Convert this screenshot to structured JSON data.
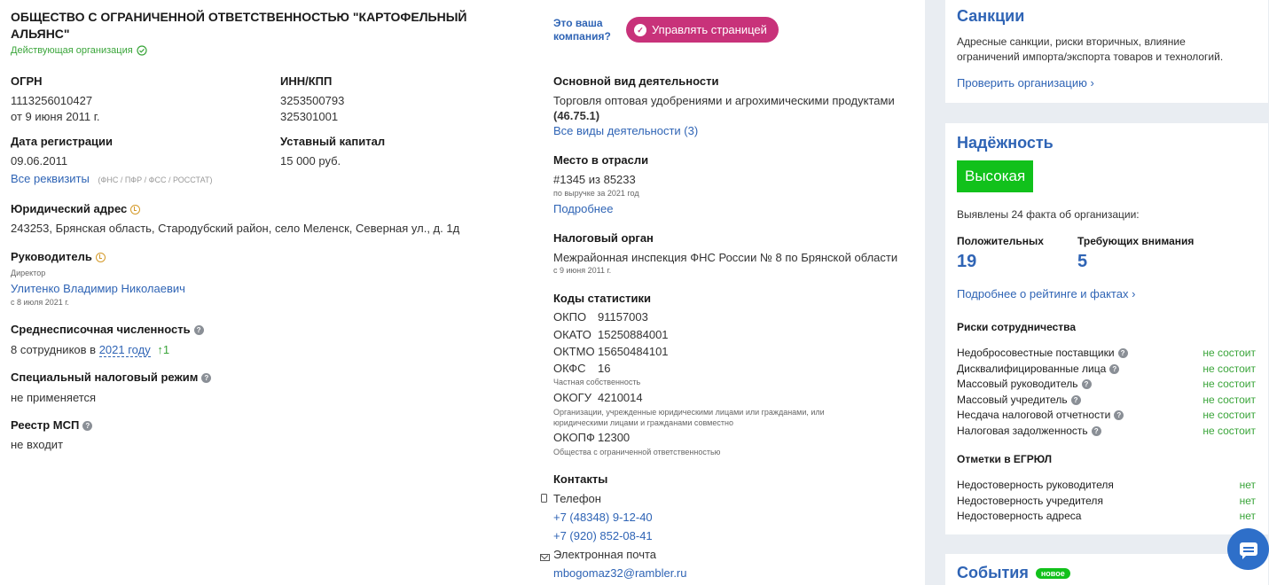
{
  "company": {
    "title": "ОБЩЕСТВО С ОГРАНИЧЕННОЙ ОТВЕТСТВЕННОСТЬЮ \"КАРТОФЕЛЬНЫЙ АЛЬЯНС\"",
    "status": "Действующая организация"
  },
  "ogrn": {
    "label": "ОГРН",
    "value": "1113256010427",
    "date": "от 9 июня 2011 г."
  },
  "inn": {
    "label": "ИНН/КПП",
    "inn": "3253500793",
    "kpp": "325301001"
  },
  "registration": {
    "label": "Дата регистрации",
    "value": "09.06.2011"
  },
  "capital": {
    "label": "Уставный капитал",
    "value": "15 000 руб."
  },
  "requisites": {
    "link": "Все реквизиты",
    "note": "(ФНС / ПФР / ФСС / РОССТАТ)"
  },
  "address": {
    "label": "Юридический адрес",
    "value": "243253, Брянская область, Стародубский район, село Меленск, Северная ул., д. 1д"
  },
  "head": {
    "label": "Руководитель",
    "role": "Директор",
    "name": "Улитенко Владимир Николаевич",
    "since": "с 8 июля 2021 г."
  },
  "employees": {
    "label": "Среднесписочная численность",
    "prefix": "8 сотрудников в",
    "year_link": "2021 году",
    "delta": "↑1"
  },
  "tax_regime": {
    "label": "Специальный налоговый режим",
    "value": "не применяется"
  },
  "msp": {
    "label": "Реестр МСП",
    "value": "не входит"
  },
  "claim": {
    "question_line1": "Это ваша",
    "question_line2": "компания?",
    "button": "Управлять страницей"
  },
  "activity": {
    "label": "Основной вид деятельности",
    "value": "Торговля оптовая удобрениями и агрохимическими продуктами",
    "code": "(46.75.1)",
    "link": "Все виды деятельности (3)"
  },
  "rank": {
    "label": "Место в отрасли",
    "value": "#1345 из 85233",
    "note": "по выручке за 2021 год",
    "link": "Подробнее"
  },
  "tax_authority": {
    "label": "Налоговый орган",
    "value": "Межрайонная инспекция ФНС России № 8 по Брянской области",
    "since": "с 9 июня 2011 г."
  },
  "stats": {
    "label": "Коды статистики",
    "okpo": {
      "k": "ОКПО",
      "v": "91157003"
    },
    "okato": {
      "k": "ОКАТО",
      "v": "15250884001"
    },
    "oktmo": {
      "k": "ОКТМО",
      "v": "15650484101"
    },
    "okfs": {
      "k": "ОКФС",
      "v": "16",
      "note": "Частная собственность"
    },
    "okogu": {
      "k": "ОКОГУ",
      "v": "4210014",
      "note1": "Организации, учрежденные юридическими лицами или гражданами, или",
      "note2": "юридическими лицами и гражданами совместно"
    },
    "okopf": {
      "k": "ОКОПФ",
      "v": "12300",
      "note": "Общества с ограниченной ответственностью"
    }
  },
  "contacts": {
    "label": "Контакты",
    "phone_label": "Телефон",
    "phone1": "+7 (48348) 9-12-40",
    "phone2": "+7 (920) 852-08-41",
    "email_label": "Электронная почта",
    "email": "mbogomaz32@rambler.ru"
  },
  "sanctions": {
    "title": "Санкции",
    "text1": "Адресные санкции, риски вторичных, влияние",
    "text2": "ограничений импорта/экспорта товаров и технологий.",
    "link": "Проверить организацию ›"
  },
  "reliability": {
    "title": "Надёжность",
    "badge": "Высокая",
    "facts": "Выявлены 24 факта об организации:",
    "positive_label": "Положительных",
    "positive_value": "19",
    "attention_label": "Требующих внимания",
    "attention_value": "5",
    "link": "Подробнее о рейтинге и фактах ›",
    "risks_title": "Риски сотрудничества",
    "risks": [
      {
        "label": "Недобросовестные поставщики",
        "value": "не состоит"
      },
      {
        "label": "Дисквалифицированные лица",
        "value": "не состоит"
      },
      {
        "label": "Массовый руководитель",
        "value": "не состоит"
      },
      {
        "label": "Массовый учредитель",
        "value": "не состоит"
      },
      {
        "label": "Несдача налоговой отчетности",
        "value": "не состоит"
      },
      {
        "label": "Налоговая задолженность",
        "value": "не состоит"
      }
    ],
    "egrul_title": "Отметки в ЕГРЮЛ",
    "egrul": [
      {
        "label": "Недостоверность руководителя",
        "value": "нет"
      },
      {
        "label": "Недостоверность учредителя",
        "value": "нет"
      },
      {
        "label": "Недостоверность адреса",
        "value": "нет"
      }
    ]
  },
  "events": {
    "title": "События",
    "badge": "новое"
  },
  "colors": {
    "accent": "#2f64b5",
    "brand": "#c8327a",
    "success": "#11c11b",
    "status_green": "#3aa53a"
  }
}
